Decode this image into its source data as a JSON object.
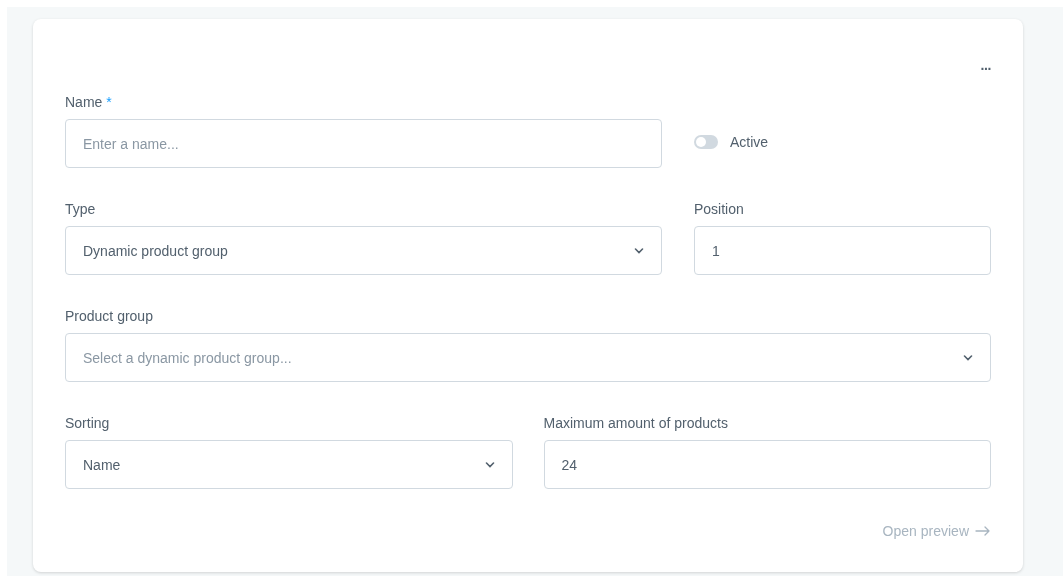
{
  "menu_button": {
    "label": "..."
  },
  "name_field": {
    "label": "Name",
    "required_mark": "*",
    "placeholder": "Enter a name..."
  },
  "active_toggle": {
    "label": "Active",
    "on": false
  },
  "type_field": {
    "label": "Type",
    "kind": "select",
    "value": "Dynamic product group"
  },
  "position_field": {
    "label": "Position",
    "value": "1"
  },
  "product_group_field": {
    "label": "Product group",
    "kind": "select",
    "placeholder": "Select a dynamic product group..."
  },
  "sorting_field": {
    "label": "Sorting",
    "kind": "select",
    "value": "Name"
  },
  "max_products_field": {
    "label": "Maximum amount of products",
    "value": "24"
  },
  "open_preview_link": {
    "label": "Open preview",
    "disabled": true
  }
}
